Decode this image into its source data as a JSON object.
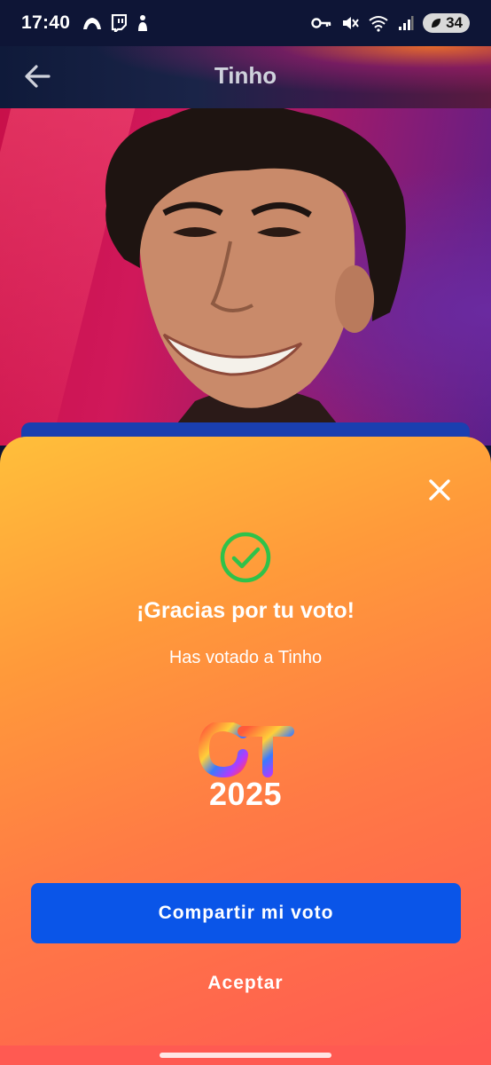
{
  "status_bar": {
    "time": "17:40",
    "battery": "34",
    "left_icons": [
      "crown-icon",
      "twitch-icon",
      "figure-icon"
    ],
    "right_icons": [
      "key-icon",
      "mute-icon",
      "wifi-icon",
      "signal-icon"
    ]
  },
  "app_bar": {
    "title": "Tinho"
  },
  "sheet": {
    "thanks_title": "¡Gracias por tu voto!",
    "voted_text": "Has votado a Tinho",
    "logo_year": "2025",
    "share_label": "Compartir mi voto",
    "accept_label": "Aceptar"
  },
  "colors": {
    "share_button": "#0a55e8",
    "check": "#2fc24a",
    "sheet_top": "#ffbf3a",
    "sheet_bottom": "#ff5a52"
  }
}
